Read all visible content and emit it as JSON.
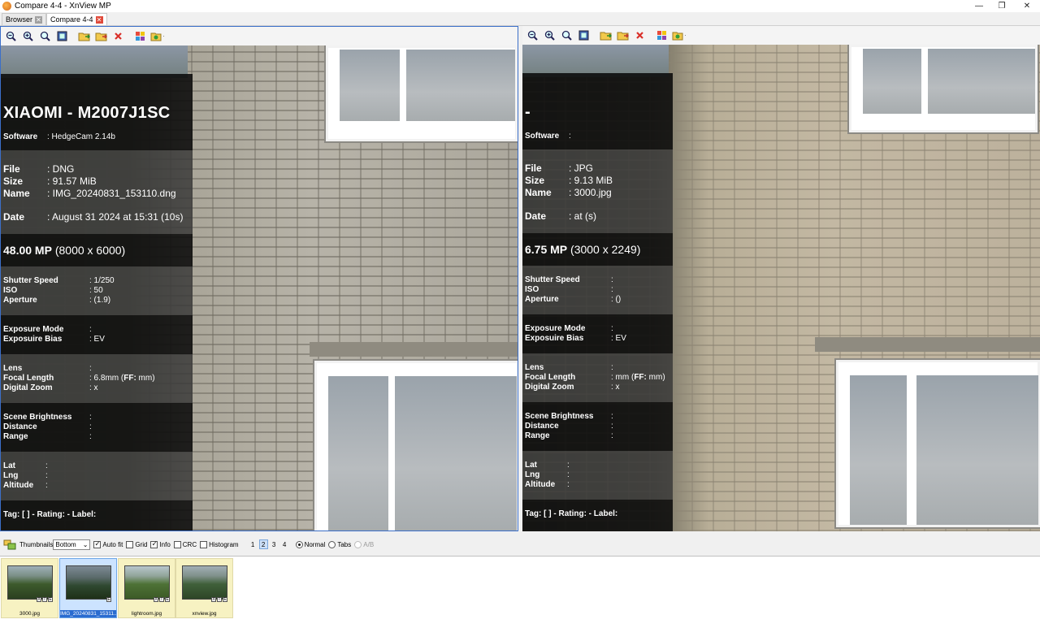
{
  "window": {
    "title": "Compare 4-4 - XnView MP",
    "minimize": "—",
    "restore": "❐",
    "close": "✕"
  },
  "tabs": [
    {
      "label": "Browser",
      "active": false
    },
    {
      "label": "Compare 4-4",
      "active": true
    }
  ],
  "toolbar": {
    "icons": [
      "zoom-out-icon",
      "zoom-in-icon",
      "zoom-fit-icon",
      "fullscreen-icon",
      "open-folder-icon",
      "copy-folder-icon",
      "delete-icon",
      "color-icon",
      "folder-export-icon"
    ]
  },
  "left": {
    "camera": "XIAOMI - M2007J1SC",
    "software_label": "Software",
    "software_value": ": HedgeCam 2.14b",
    "file_label": "File",
    "file_value": ": DNG",
    "size_label": "Size",
    "size_value": ": 91.57 MiB",
    "name_label": "Name",
    "name_value": ": IMG_20240831_153110.dng",
    "date_label": "Date",
    "date_value": ": August 31 2024 at 15:31 (10s)",
    "mp_value": "48.00 MP",
    "mp_dims": "(8000 x 6000)",
    "shutter_label": "Shutter Speed",
    "shutter_value": ": 1/250",
    "iso_label": "ISO",
    "iso_value": ": 50",
    "aperture_label": "Aperture",
    "aperture_value": ":  (1.9)",
    "expmode_label": "Exposure Mode",
    "expmode_value": ":",
    "expbias_label": "Exposuire Bias",
    "expbias_value": ":   EV",
    "lens_label": "Lens",
    "lens_value": ":",
    "focal_label": "Focal Length",
    "focal_value_a": ": 6.8mm (",
    "focal_ff": "FF:",
    "focal_value_b": " mm)",
    "dzoom_label": "Digital Zoom",
    "dzoom_value": ": x",
    "scene_label": "Scene Brightness",
    "scene_value": ":",
    "distance_label": "Distance",
    "distance_value": ":",
    "range_label": "Range",
    "range_value": ":",
    "lat_label": "Lat",
    "lat_value": ":",
    "lng_label": "Lng",
    "lng_value": ":",
    "alt_label": "Altitude",
    "alt_value": ":",
    "tagline": "Tag: [ ] - Rating:  - Label:"
  },
  "right": {
    "camera": "-",
    "software_label": "Software",
    "software_value": ":",
    "file_label": "File",
    "file_value": ": JPG",
    "size_label": "Size",
    "size_value": ": 9.13 MiB",
    "name_label": "Name",
    "name_value": ": 3000.jpg",
    "date_label": "Date",
    "date_value": ":  at  (s)",
    "mp_value": "6.75 MP",
    "mp_dims": "(3000 x 2249)",
    "shutter_label": "Shutter Speed",
    "shutter_value": ":",
    "iso_label": "ISO",
    "iso_value": ":",
    "aperture_label": "Aperture",
    "aperture_value": ":  ()",
    "expmode_label": "Exposure Mode",
    "expmode_value": ":",
    "expbias_label": "Exposuire Bias",
    "expbias_value": ":   EV",
    "lens_label": "Lens",
    "lens_value": ":",
    "focal_label": "Focal Length",
    "focal_value_a": ":  mm (",
    "focal_ff": "FF:",
    "focal_value_b": " mm)",
    "dzoom_label": "Digital Zoom",
    "dzoom_value": ": x",
    "scene_label": "Scene Brightness",
    "scene_value": ":",
    "distance_label": "Distance",
    "distance_value": ":",
    "range_label": "Range",
    "range_value": ":",
    "lat_label": "Lat",
    "lat_value": ":",
    "lng_label": "Lng",
    "lng_value": ":",
    "alt_label": "Altitude",
    "alt_value": ":",
    "tagline": "Tag: [ ] - Rating:  - Label:"
  },
  "bottombar": {
    "thumbnails_label": "Thumbnails",
    "thumbnails_position": "Bottom",
    "autofit_label": "Auto fit",
    "grid_label": "Grid",
    "info_label": "Info",
    "crc_label": "CRC",
    "histogram_label": "Histogram",
    "pages": [
      "1",
      "2",
      "3",
      "4"
    ],
    "normal_label": "Normal",
    "tabs_label": "Tabs",
    "ab_label": "A/B"
  },
  "filmstrip": [
    {
      "caption": "3000.jpg",
      "selected": false,
      "badges": [
        "X",
        "I",
        "E"
      ]
    },
    {
      "caption": "IMG_20240831_15311...",
      "selected": true,
      "badges": [
        "E"
      ]
    },
    {
      "caption": "lightroom.jpg",
      "selected": false,
      "badges": [
        "X",
        "I",
        "E"
      ]
    },
    {
      "caption": "xnview.jpg",
      "selected": false,
      "badges": [
        "X",
        "I",
        "E"
      ]
    }
  ]
}
